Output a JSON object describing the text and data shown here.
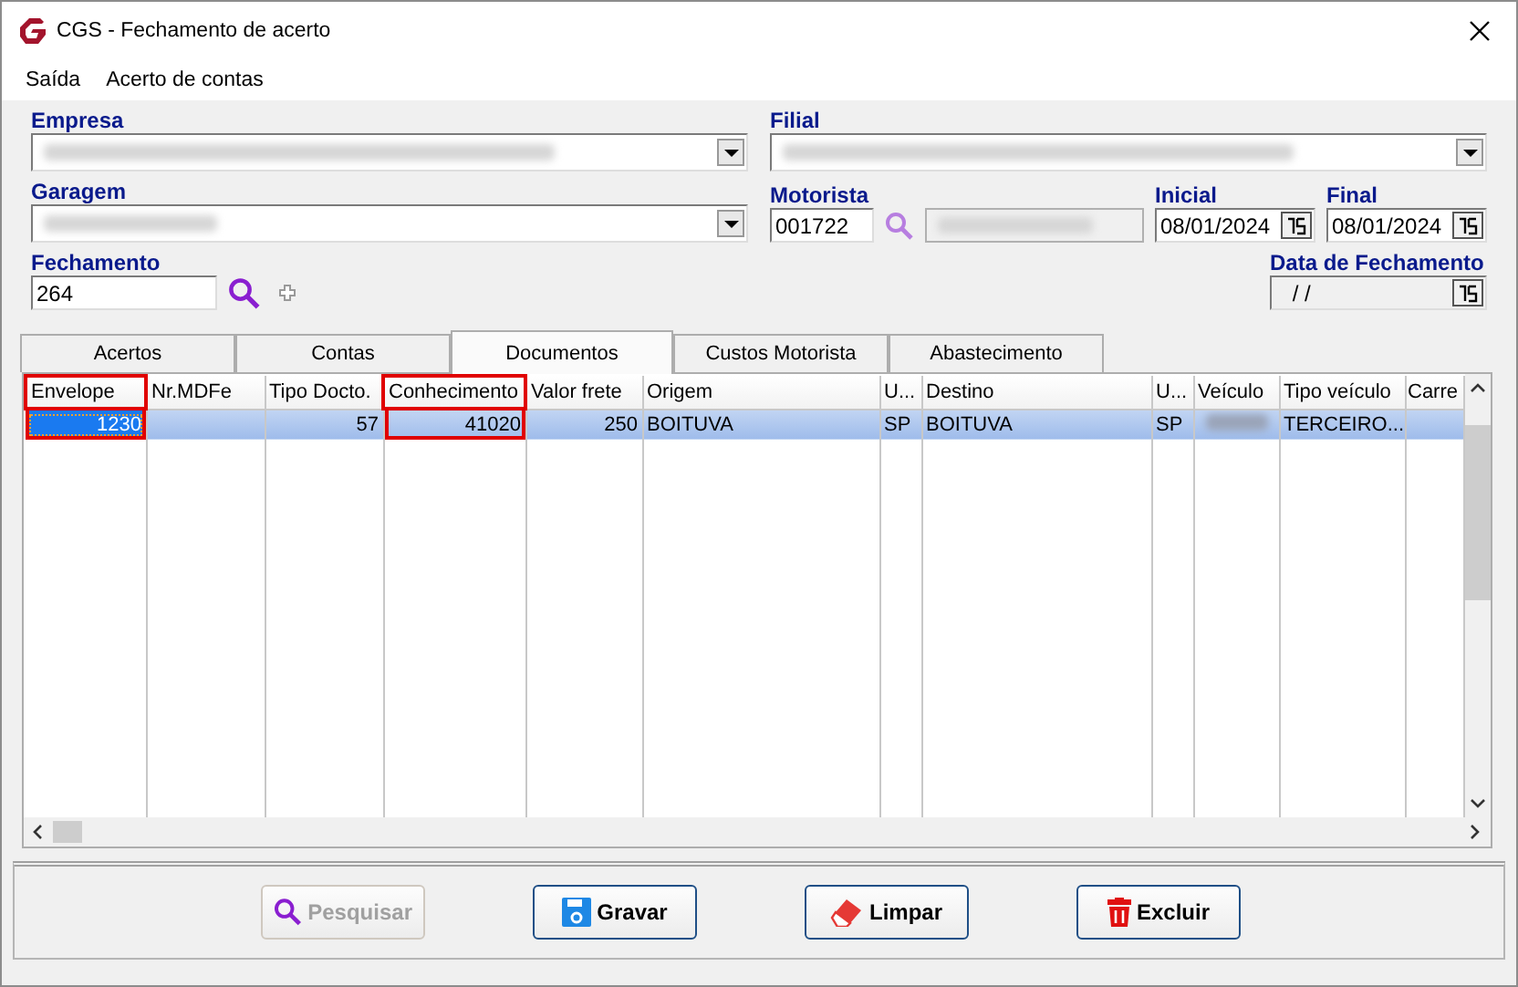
{
  "window": {
    "title": "CGS - Fechamento de acerto"
  },
  "menu": [
    "Saída",
    "Acerto de contas"
  ],
  "empresa": {
    "label": "Empresa",
    "blurred": true
  },
  "filial": {
    "label": "Filial",
    "blurred": true
  },
  "garagem": {
    "label": "Garagem",
    "blurred": true
  },
  "motorista": {
    "label": "Motorista",
    "value": "001722",
    "name_blurred": true
  },
  "inicial": {
    "label": "Inicial",
    "value": "08/01/2024"
  },
  "final": {
    "label": "Final",
    "value": "08/01/2024"
  },
  "fechamento": {
    "label": "Fechamento",
    "value": "264"
  },
  "data_fechamento": {
    "label": "Data de Fechamento",
    "value": " / /"
  },
  "tabs": [
    {
      "label": "Acertos",
      "selected": false
    },
    {
      "label": "Contas",
      "selected": false
    },
    {
      "label": "Documentos",
      "selected": true
    },
    {
      "label": "Custos Motorista",
      "selected": false
    },
    {
      "label": "Abastecimento",
      "selected": false
    }
  ],
  "table": {
    "columns": [
      {
        "label": "Envelope",
        "highlighted": true
      },
      {
        "label": "Nr.MDFe",
        "highlighted": false
      },
      {
        "label": "Tipo Docto.",
        "highlighted": false
      },
      {
        "label": "Conhecimento",
        "highlighted": true
      },
      {
        "label": "Valor frete",
        "highlighted": false
      },
      {
        "label": "Origem",
        "highlighted": false
      },
      {
        "label": "U...",
        "highlighted": false
      },
      {
        "label": "Destino",
        "highlighted": false
      },
      {
        "label": "U...",
        "highlighted": false
      },
      {
        "label": "Veículo",
        "highlighted": false
      },
      {
        "label": "Tipo veículo",
        "highlighted": false
      },
      {
        "label": "Carre",
        "highlighted": false
      }
    ],
    "rows": [
      {
        "selected": true,
        "cells": [
          {
            "kind": "text",
            "text": "1230",
            "focused": true
          },
          {
            "kind": "empty"
          },
          {
            "kind": "text",
            "text": "57"
          },
          {
            "kind": "text",
            "text": "41020"
          },
          {
            "kind": "text",
            "text": "250"
          },
          {
            "kind": "text",
            "text": "BOITUVA"
          },
          {
            "kind": "text",
            "text": "SP"
          },
          {
            "kind": "text",
            "text": "BOITUVA"
          },
          {
            "kind": "text",
            "text": "SP"
          },
          {
            "kind": "blurred"
          },
          {
            "kind": "text",
            "text": "TERCEIRO..."
          },
          {
            "kind": "empty"
          }
        ]
      }
    ]
  },
  "buttons": [
    {
      "label": "Pesquisar",
      "disabled": true
    },
    {
      "label": "Gravar",
      "disabled": false
    },
    {
      "label": "Limpar",
      "disabled": false
    },
    {
      "label": "Excluir",
      "disabled": false
    }
  ]
}
